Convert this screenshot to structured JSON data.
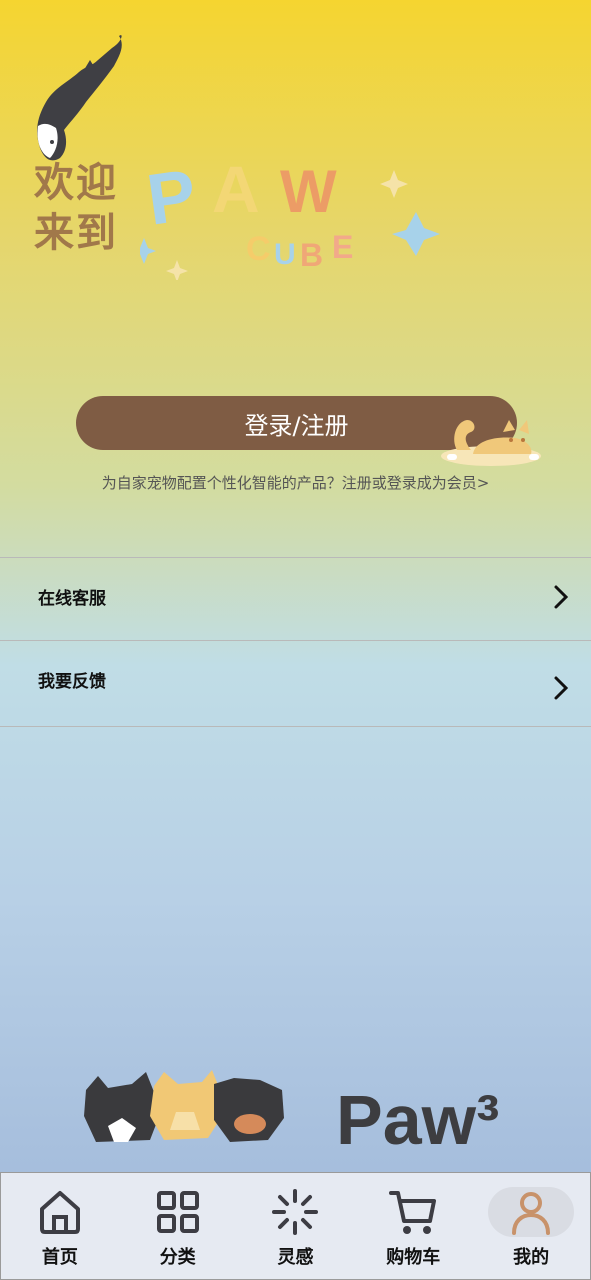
{
  "header": {
    "welcome_line1": "欢迎",
    "welcome_line2": "来到",
    "logo_text": "PAW CUBE"
  },
  "login": {
    "button_label": "登录/注册",
    "promo_text": "为自家宠物配置个性化智能的产品？注册或登录成为会员>"
  },
  "menu": [
    {
      "label": "在线客服"
    },
    {
      "label": "我要反馈"
    }
  ],
  "footer_brand": "Paw³",
  "tabs": [
    {
      "label": "首页",
      "icon": "home-icon"
    },
    {
      "label": "分类",
      "icon": "grid-icon"
    },
    {
      "label": "灵感",
      "icon": "sparkle-icon"
    },
    {
      "label": "购物车",
      "icon": "cart-icon"
    },
    {
      "label": "我的",
      "icon": "user-icon",
      "active": true
    }
  ],
  "colors": {
    "button_bg": "#7f5c44",
    "welcome_text": "#a1784a",
    "tabbar_bg": "#e6eaf2"
  }
}
